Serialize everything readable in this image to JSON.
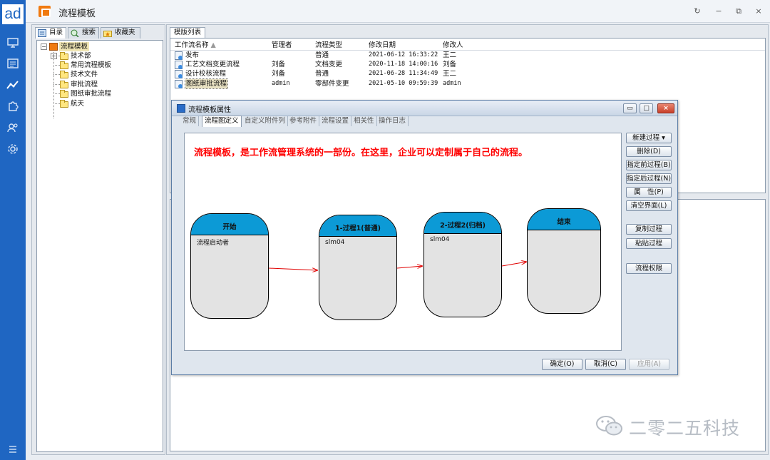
{
  "app": {
    "logo": "ad",
    "title": "流程模板",
    "brand_color": "#1f66c2",
    "rail_icons": [
      "monitor-icon",
      "list-icon",
      "trend-icon",
      "puzzle-icon",
      "users-icon",
      "gear-icon",
      "menu-icon"
    ],
    "window_controls": [
      "↻",
      "−",
      "⧉",
      "×"
    ]
  },
  "left_panel": {
    "tabs": [
      "目录",
      "搜索",
      "收藏夹"
    ],
    "tree": {
      "root": "流程模板",
      "children": [
        "技术部",
        "常用流程模板",
        "技术文件",
        "审批流程",
        "图纸审批流程",
        "航天"
      ]
    }
  },
  "template_list": {
    "tab": "模版列表",
    "columns": [
      "工作流名称",
      "管理者",
      "流程类型",
      "修改日期",
      "修改人"
    ],
    "rows": [
      [
        "发布",
        "",
        "普通",
        "2021-06-12 16:33:22",
        "王二"
      ],
      [
        "工艺文档变更流程",
        "刘备",
        "文档变更",
        "2020-11-18 14:00:16",
        "刘备"
      ],
      [
        "设计校核流程",
        "刘备",
        "普通",
        "2021-06-28 11:34:49",
        "王二"
      ],
      [
        "图纸审批流程",
        "admin",
        "零部件变更",
        "2021-05-10 09:59:39",
        "admin"
      ]
    ]
  },
  "dialog": {
    "title": "流程模板属性",
    "tabs": [
      "常规",
      "流程图定义",
      "自定义附件列",
      "参考附件",
      "流程设置",
      "相关性",
      "操作日志"
    ],
    "active_tab": "流程图定义",
    "banner": "流程模板，是工作流管理系统的一部份。在这里，企业可以定制属于自己的流程。",
    "nodes": [
      {
        "title": "开始",
        "body": "流程启动者"
      },
      {
        "title": "1-过程1(普通)",
        "body": "slm04"
      },
      {
        "title": "2-过程2(归档)",
        "body": "slm04"
      },
      {
        "title": "结束",
        "body": ""
      }
    ],
    "side_buttons": [
      "新建过程 ▾",
      "删除(D)",
      "指定前过程(B)",
      "指定后过程(N)",
      "属　性(P)",
      "清空界面(L)",
      "复制过程",
      "粘贴过程",
      "流程权限"
    ],
    "footer_buttons": [
      "确定(O)",
      "取消(C)",
      "应用(A)"
    ],
    "node_header_color": "#0c9ad6",
    "arrow_color": "#e00000",
    "banner_color": "#ff0000"
  },
  "watermark": "二零二五科技"
}
